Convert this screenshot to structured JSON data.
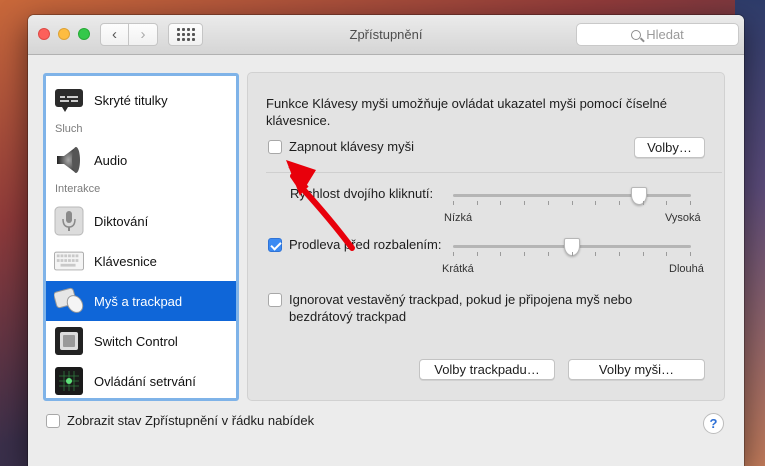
{
  "window": {
    "title": "Zpřístupnění",
    "search_placeholder": "Hledat"
  },
  "sidebar": {
    "items": [
      {
        "label": "Skryté titulky",
        "icon": "captions-icon"
      },
      {
        "label": "Audio",
        "icon": "speaker-icon"
      },
      {
        "label": "Diktování",
        "icon": "microphone-icon"
      },
      {
        "label": "Klávesnice",
        "icon": "keyboard-icon"
      },
      {
        "label": "Myš a trackpad",
        "icon": "mouse-trackpad-icon",
        "selected": true
      },
      {
        "label": "Switch Control",
        "icon": "switch-control-icon"
      },
      {
        "label": "Ovládání setrvání",
        "icon": "dwell-control-icon"
      }
    ],
    "sections": [
      "Sluch",
      "Interakce"
    ]
  },
  "pane": {
    "description": "Funkce Klávesy myši umožňuje ovládat ukazatel myši pomocí číselné klávesnice.",
    "mouse_keys_label": "Zapnout klávesy myši",
    "mouse_keys_checked": false,
    "options_button": "Volby…",
    "double_click_label": "Rychlost dvojího kliknutí:",
    "double_click_min": "Nízká",
    "double_click_max": "Vysoká",
    "double_click_value": 0.8,
    "spring_loading_label": "Prodleva před rozbalením:",
    "spring_loading_checked": true,
    "spring_min": "Krátká",
    "spring_max": "Dlouhá",
    "spring_value": 0.5,
    "ignore_trackpad_label": "Ignorovat vestavěný trackpad, pokud je připojena myš nebo bezdrátový trackpad",
    "ignore_trackpad_checked": false,
    "trackpad_options_button": "Volby trackpadu…",
    "mouse_options_button": "Volby myši…"
  },
  "footer": {
    "show_status_label": "Zobrazit stav Zpřístupnění v řádku nabídek",
    "show_status_checked": false,
    "help": "?"
  },
  "colors": {
    "selection": "#0f66d8",
    "checkbox_on": "#3b8bf3",
    "annotation_arrow": "#e8000b"
  }
}
